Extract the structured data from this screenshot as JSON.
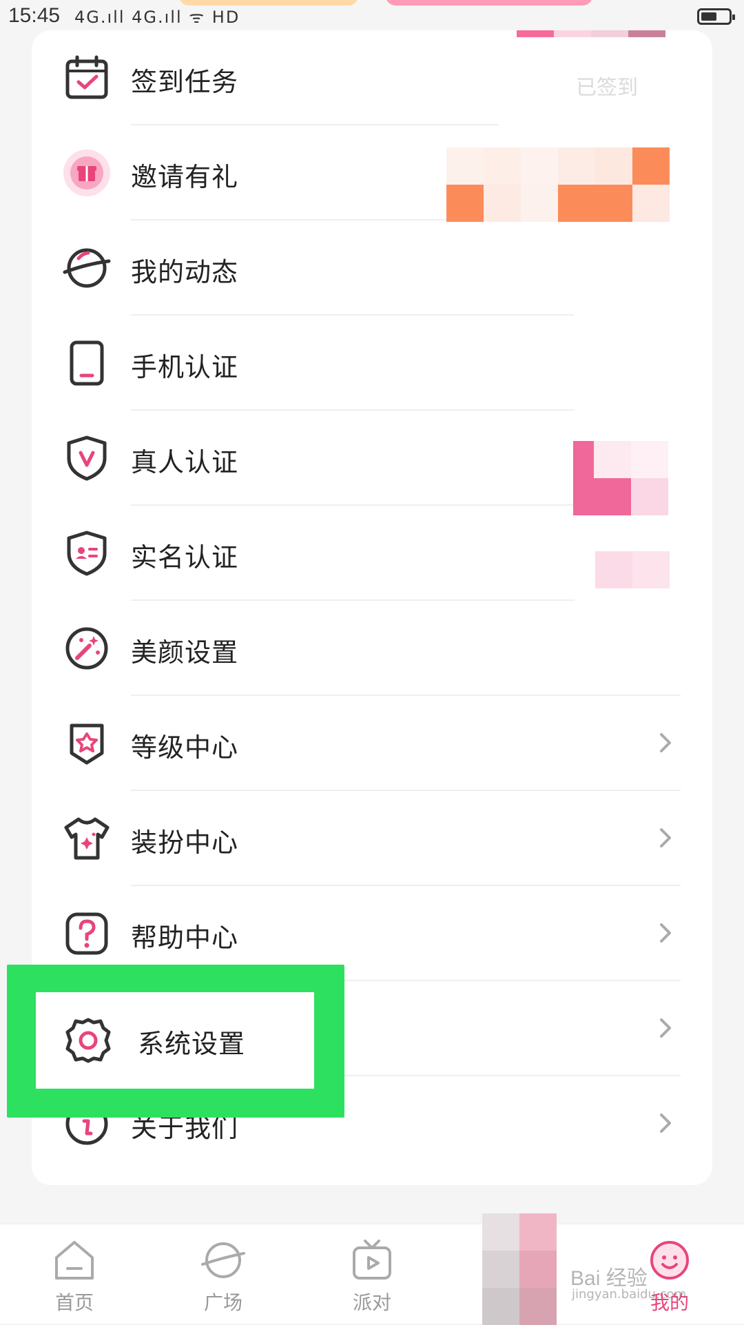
{
  "status_bar": {
    "time": "15:45",
    "signal_text": "4G.ıll 4G.ıll ᯤ HD"
  },
  "menu": {
    "items": [
      {
        "label": "签到任务",
        "icon": "calendar-check-icon",
        "trailing": "已签到"
      },
      {
        "label": "邀请有礼",
        "icon": "gift-icon"
      },
      {
        "label": "我的动态",
        "icon": "planet-icon"
      },
      {
        "label": "手机认证",
        "icon": "phone-icon"
      },
      {
        "label": "真人认证",
        "icon": "shield-v-icon"
      },
      {
        "label": "实名认证",
        "icon": "shield-id-icon"
      },
      {
        "label": "美颜设置",
        "icon": "beauty-wand-icon"
      },
      {
        "label": "等级中心",
        "icon": "level-badge-icon"
      },
      {
        "label": "装扮中心",
        "icon": "shirt-icon"
      },
      {
        "label": "帮助中心",
        "icon": "help-icon"
      },
      {
        "label": "系统设置",
        "icon": "gear-icon"
      },
      {
        "label": "关于我们",
        "icon": "info-icon"
      }
    ]
  },
  "bottom_nav": {
    "home": "首页",
    "square": "广场",
    "party": "派对",
    "mine": "我的"
  },
  "watermark": {
    "text": "Bai 经验",
    "sub": "jingyan.baidu.com"
  },
  "colors": {
    "accent": "#e8457a",
    "highlight": "#2de060",
    "mosaic_orange": "#fb8c5a",
    "mosaic_pink": "#f0679a"
  }
}
